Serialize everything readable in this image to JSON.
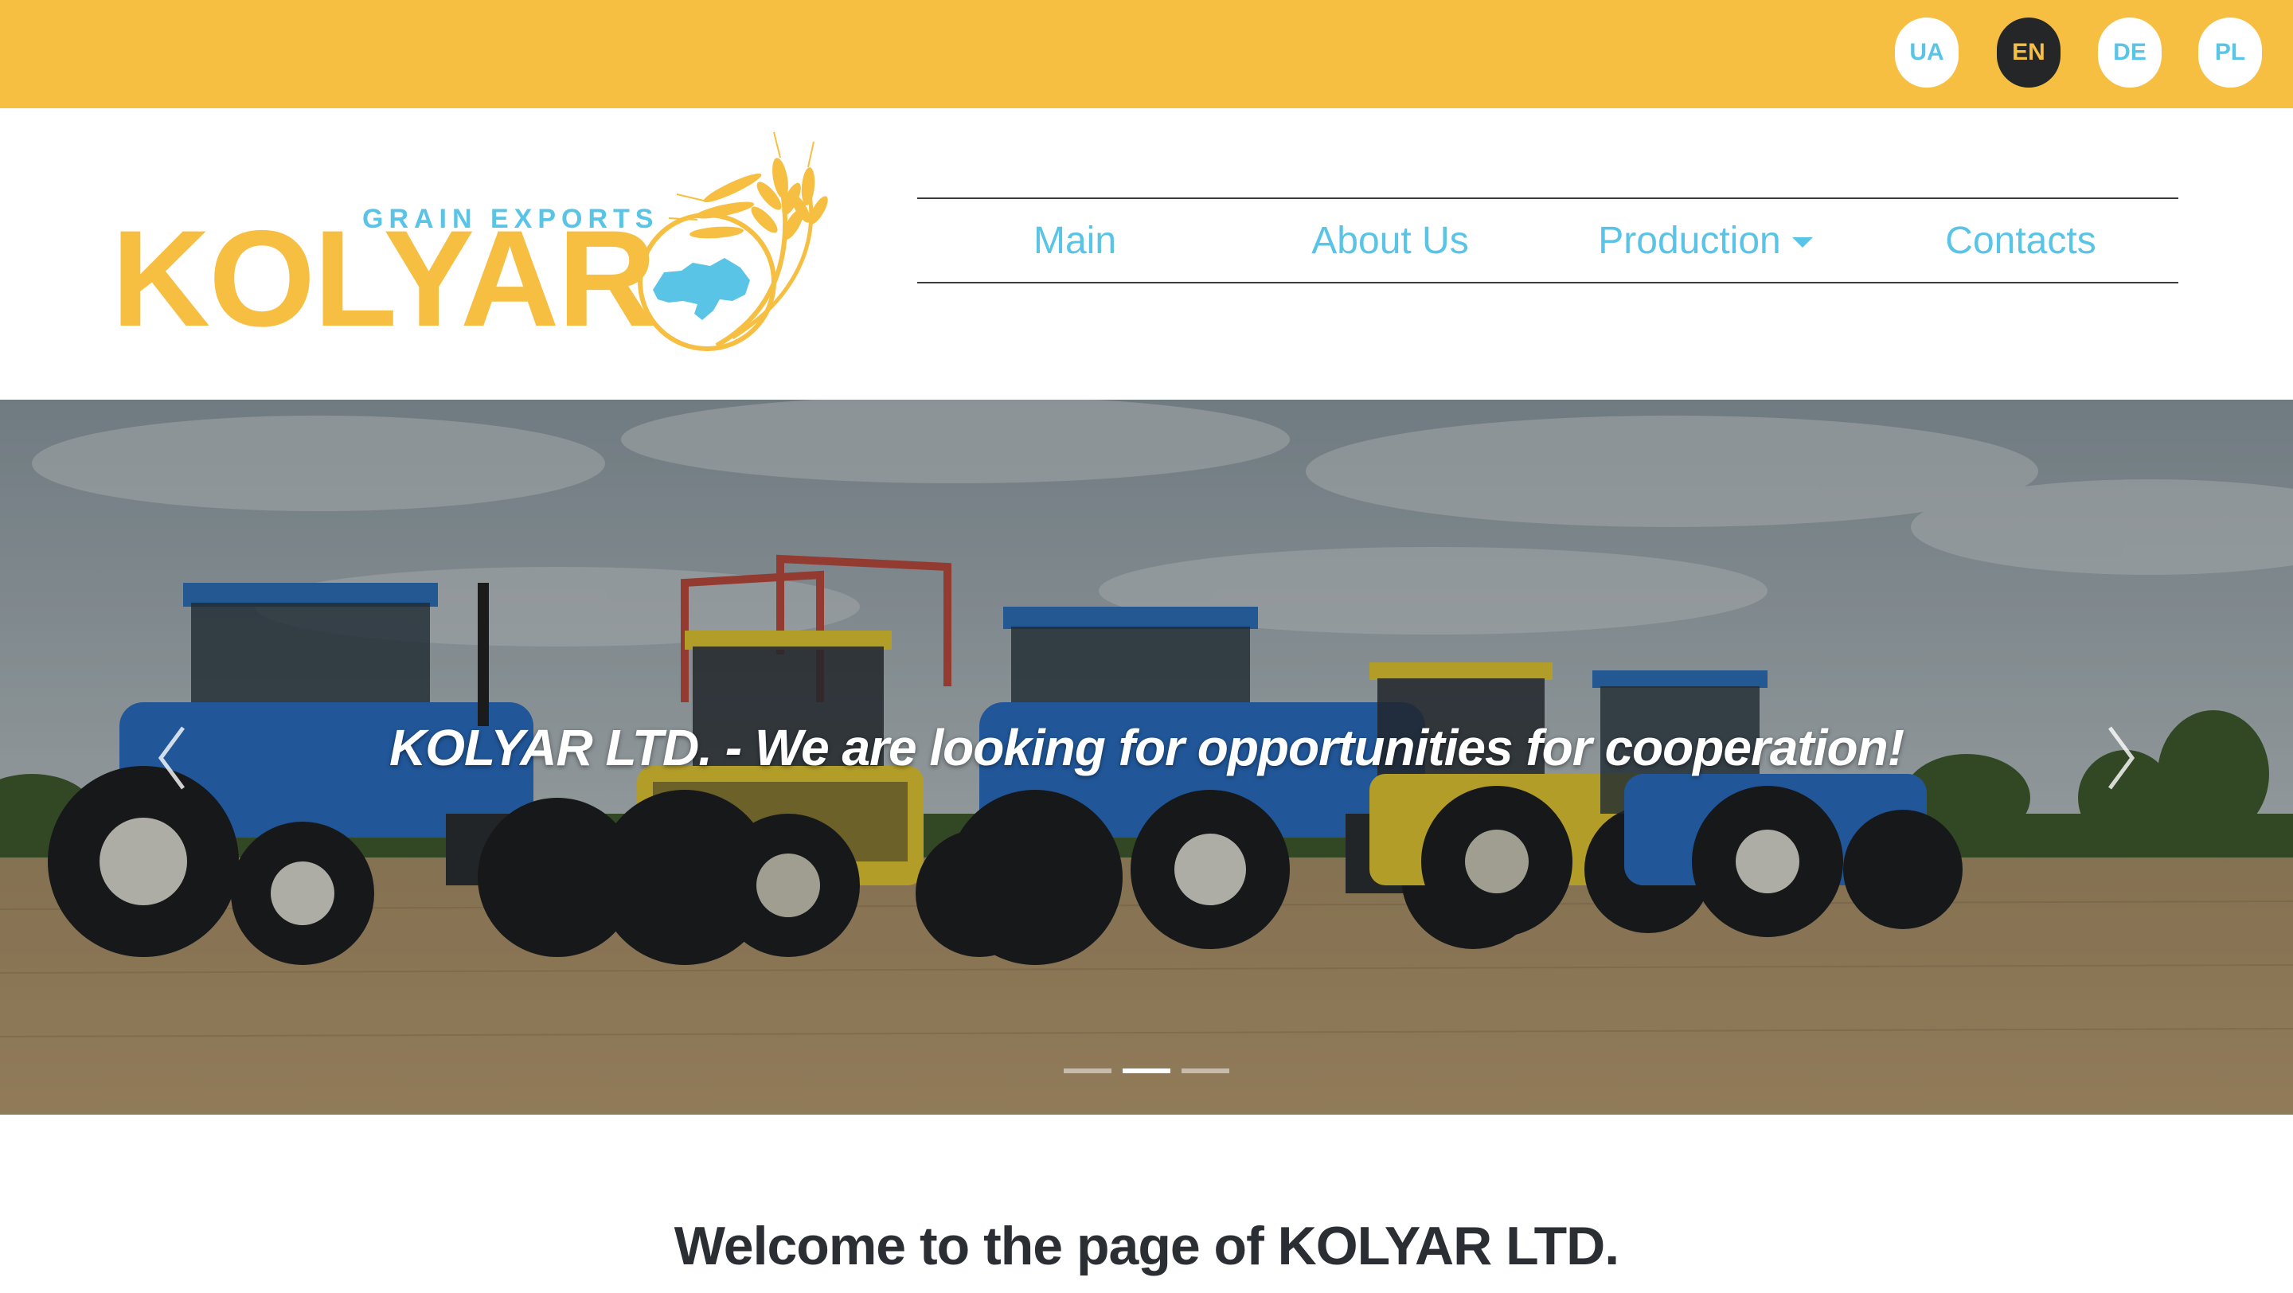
{
  "languages": [
    {
      "code": "UA",
      "active": false
    },
    {
      "code": "EN",
      "active": true
    },
    {
      "code": "DE",
      "active": false
    },
    {
      "code": "PL",
      "active": false
    }
  ],
  "logo": {
    "tagline": "GRAIN  EXPORTS",
    "wordmark": "KOLYAR"
  },
  "nav": {
    "items": [
      {
        "label": "Main"
      },
      {
        "label": "About Us"
      },
      {
        "label": "Production",
        "has_dropdown": true
      },
      {
        "label": "Contacts"
      }
    ]
  },
  "carousel": {
    "caption": "KOLYAR LTD. - We are looking for opportunities for cooperation!",
    "slide_count": 3,
    "active_slide": 2,
    "prev_icon": "chevron-left-icon",
    "next_icon": "chevron-right-icon"
  },
  "welcome": {
    "heading": "Welcome to the page of KOLYAR LTD."
  },
  "colors": {
    "brand_yellow": "#f6bf42",
    "accent_blue": "#5ac4e6",
    "dark": "#242628"
  }
}
